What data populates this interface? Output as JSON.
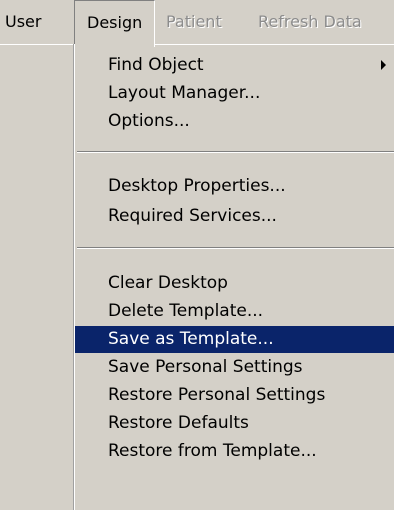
{
  "menubar": {
    "items": [
      {
        "label": "User",
        "state": "normal"
      },
      {
        "label": "Design",
        "state": "open"
      },
      {
        "label": "Patient",
        "state": "disabled"
      },
      {
        "label": "Refresh Data",
        "state": "disabled"
      }
    ]
  },
  "design_menu": {
    "groups": [
      {
        "items": [
          {
            "label": "Find Object",
            "submenu": true
          },
          {
            "label": "Layout Manager..."
          },
          {
            "label": "Options..."
          }
        ]
      },
      {
        "items": [
          {
            "label": "Desktop Properties..."
          },
          {
            "label": "Required Services..."
          }
        ]
      },
      {
        "items": [
          {
            "label": "Clear Desktop"
          },
          {
            "label": "Delete Template..."
          },
          {
            "label": "Save as Template...",
            "selected": true
          },
          {
            "label": "Save Personal Settings"
          },
          {
            "label": "Restore Personal Settings"
          },
          {
            "label": "Restore Defaults"
          },
          {
            "label": "Restore from Template..."
          }
        ]
      }
    ]
  },
  "colors": {
    "menu_background": "#d4d0c8",
    "selection_background": "#0a246a",
    "selection_text": "#ffffff",
    "disabled_text": "#8c8c8c"
  }
}
